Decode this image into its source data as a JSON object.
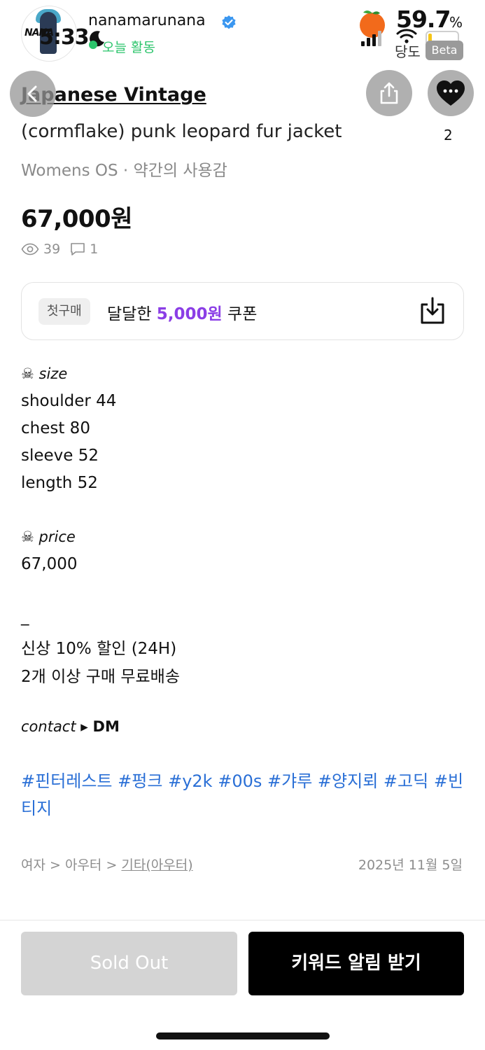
{
  "status_bar": {
    "time": "5:33",
    "battery_percent": "59.7",
    "battery_unit": "%",
    "battery_level": 0.12,
    "region": "당도",
    "beta_label": "Beta"
  },
  "seller": {
    "avatar_text": "NANA",
    "username": "nanamarunana",
    "activity": "오늘 활동"
  },
  "product": {
    "brand": "Japanese Vintage",
    "title": "(cormflake) punk leopard fur jacket",
    "subtitle": "Womens OS · 약간의 사용감",
    "price": "67,000원",
    "views": "39",
    "comments": "1",
    "likes": "2"
  },
  "coupon": {
    "tag": "첫구매",
    "text_before": "달달한 ",
    "amount": "5,000원",
    "text_after": " 쿠폰"
  },
  "description": {
    "size_heading": "size",
    "size_lines": [
      "shoulder 44",
      "chest 80",
      "sleeve 52",
      "length 52"
    ],
    "price_heading": "price",
    "price_value": "67,000",
    "dash": "_",
    "promo_lines": [
      "신상 10% 할인 (24H)",
      "2개 이상 구매 무료배송"
    ],
    "contact_label": "contact",
    "contact_arrow": "▸",
    "contact_value": "DM",
    "skull_glyph": "☠"
  },
  "hashtags": [
    "#핀터레스트",
    "#펑크",
    "#y2k",
    "#00s",
    "#갸루",
    "#양지뢰",
    "#고딕",
    "#빈티지"
  ],
  "breadcrumb": {
    "level1": "여자",
    "level2": "아우터",
    "level3": "기타(아우터)",
    "separator": " > "
  },
  "date": "2025년 11월 5일",
  "actions": {
    "sold_out": "Sold Out",
    "keyword_alert": "키워드 알림 받기"
  },
  "colors": {
    "accent_purple": "#8b3ee6",
    "hashtag_blue": "#2a6fd6",
    "active_green": "#2bc46b"
  },
  "icons": [
    "back-icon",
    "share-icon",
    "heart-icon",
    "eye-icon",
    "comment-icon",
    "download-icon",
    "verified-icon",
    "moon-icon",
    "wifi-icon",
    "signal-icon",
    "battery-icon",
    "tangerine-icon"
  ]
}
